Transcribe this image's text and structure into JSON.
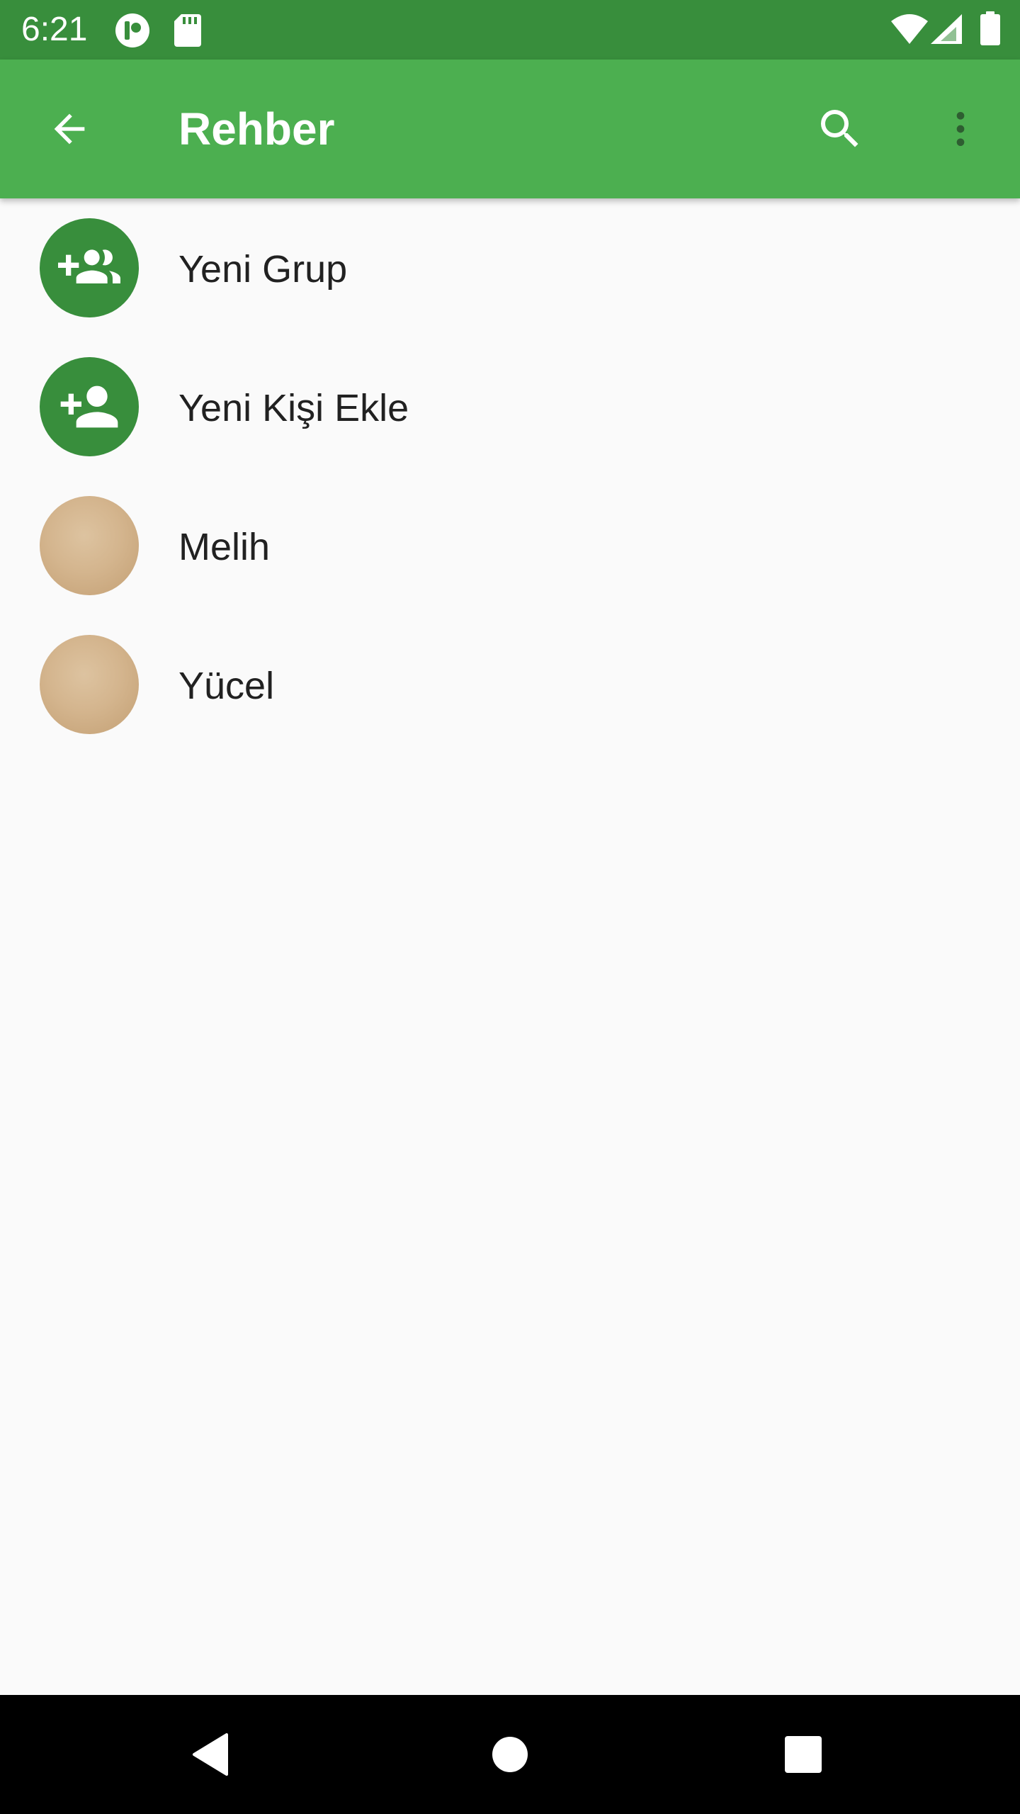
{
  "status_bar": {
    "time": "6:21",
    "background": "#388e3c",
    "icons": [
      "notification-app-icon",
      "sd-card-icon",
      "wifi-icon",
      "cell-signal-icon",
      "battery-icon"
    ]
  },
  "app_bar": {
    "title": "Rehber",
    "background": "#4caf50",
    "back_icon": "arrow-back-icon",
    "search_icon": "search-icon",
    "menu_icon": "more-vert-icon"
  },
  "contacts": {
    "items": [
      {
        "label": "Yeni Grup",
        "avatar_type": "action",
        "icon": "group-add-icon"
      },
      {
        "label": "Yeni Kişi Ekle",
        "avatar_type": "action",
        "icon": "person-add-icon"
      },
      {
        "label": "Melih",
        "avatar_type": "photo"
      },
      {
        "label": "Yücel",
        "avatar_type": "photo"
      }
    ],
    "action_avatar_color": "#388e3c"
  },
  "nav_bar": {
    "buttons": [
      "back-triangle-icon",
      "home-circle-icon",
      "recents-square-icon"
    ]
  }
}
